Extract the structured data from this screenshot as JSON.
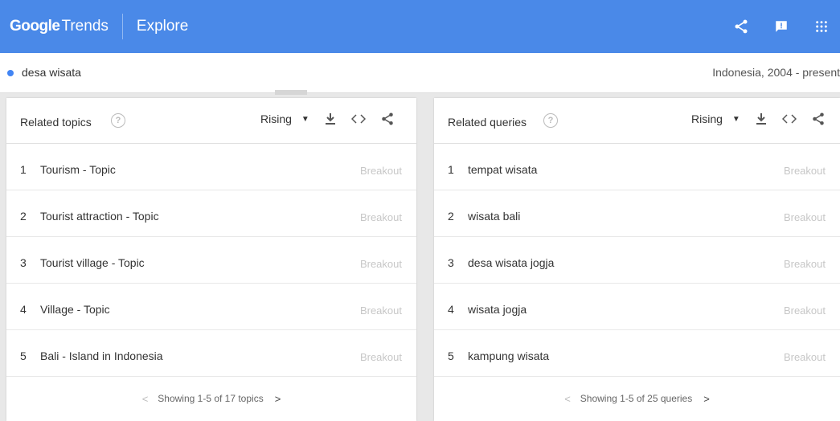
{
  "header": {
    "logo_google": "Google",
    "logo_trends": "Trends",
    "section": "Explore",
    "icons": [
      "share-icon",
      "feedback-icon",
      "apps-grid-icon"
    ]
  },
  "search": {
    "term": "desa wisata",
    "meta": "Indonesia, 2004 - present",
    "term_color": "#4285f4"
  },
  "topics": {
    "title": "Related topics",
    "filter": "Rising",
    "items": [
      {
        "rank": "1",
        "name": "Tourism - Topic",
        "value": "Breakout"
      },
      {
        "rank": "2",
        "name": "Tourist attraction - Topic",
        "value": "Breakout"
      },
      {
        "rank": "3",
        "name": "Tourist village - Topic",
        "value": "Breakout"
      },
      {
        "rank": "4",
        "name": "Village - Topic",
        "value": "Breakout"
      },
      {
        "rank": "5",
        "name": "Bali - Island in Indonesia",
        "value": "Breakout"
      }
    ],
    "pager": "Showing 1-5 of 17 topics"
  },
  "queries": {
    "title": "Related queries",
    "filter": "Rising",
    "items": [
      {
        "rank": "1",
        "name": "tempat wisata",
        "value": "Breakout"
      },
      {
        "rank": "2",
        "name": "wisata bali",
        "value": "Breakout"
      },
      {
        "rank": "3",
        "name": "desa wisata jogja",
        "value": "Breakout"
      },
      {
        "rank": "4",
        "name": "wisata jogja",
        "value": "Breakout"
      },
      {
        "rank": "5",
        "name": "kampung wisata",
        "value": "Breakout"
      }
    ],
    "pager": "Showing 1-5 of 25 queries"
  },
  "colors": {
    "header_bg": "#4a89e8",
    "breakout": "#c7c7c7"
  }
}
